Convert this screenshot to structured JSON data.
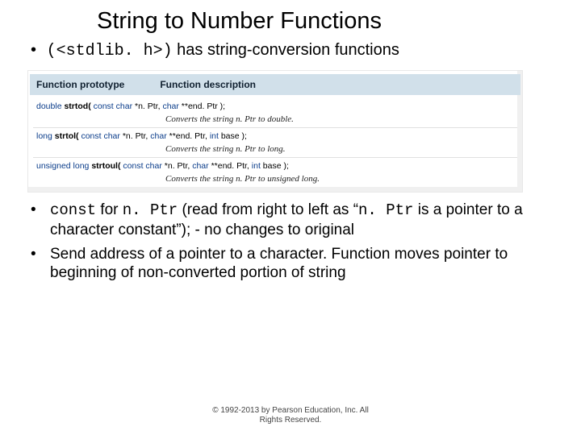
{
  "title": "String to Number Functions",
  "intro": {
    "prefix": "(",
    "header": "<stdlib. h>",
    "suffix": ")",
    "rest": " has string-conversion functions"
  },
  "table": {
    "head_proto": "Function prototype",
    "head_desc": "Function description",
    "rows": [
      {
        "kw1": "double",
        "fn": "strtod(",
        "kw2": "const char",
        "mid": " *n. Ptr, ",
        "kw3": "char",
        "tail": " **end. Ptr );",
        "kw4": "",
        "tail2": "",
        "desc": "Converts the string n. Ptr to double."
      },
      {
        "kw1": "long",
        "fn": "strtol(",
        "kw2": "const char",
        "mid": " *n. Ptr, ",
        "kw3": "char",
        "tail": " **end. Ptr, ",
        "kw4": "int",
        "tail2": " base );",
        "desc": "Converts the string n. Ptr to long."
      },
      {
        "kw1": "unsigned long",
        "fn": "strtoul(",
        "kw2": "const char",
        "mid": " *n. Ptr, ",
        "kw3": "char",
        "tail": " **end. Ptr, ",
        "kw4": "int",
        "tail2": " base );",
        "desc": "Converts the string n. Ptr to unsigned long."
      }
    ]
  },
  "bullets": [
    {
      "code1": "const",
      "t1": " for ",
      "code2": "n. Ptr",
      "t2": " (read from right to left as “",
      "code3": "n. Ptr",
      "t3": " is a pointer to a character constant”); - no changes to original"
    },
    {
      "t1": "Send address of a pointer to a character. Function moves pointer to beginning of non-converted portion of string"
    }
  ],
  "footer": {
    "line1": "© 1992-2013 by Pearson Education, Inc. All",
    "line2": "Rights Reserved."
  }
}
